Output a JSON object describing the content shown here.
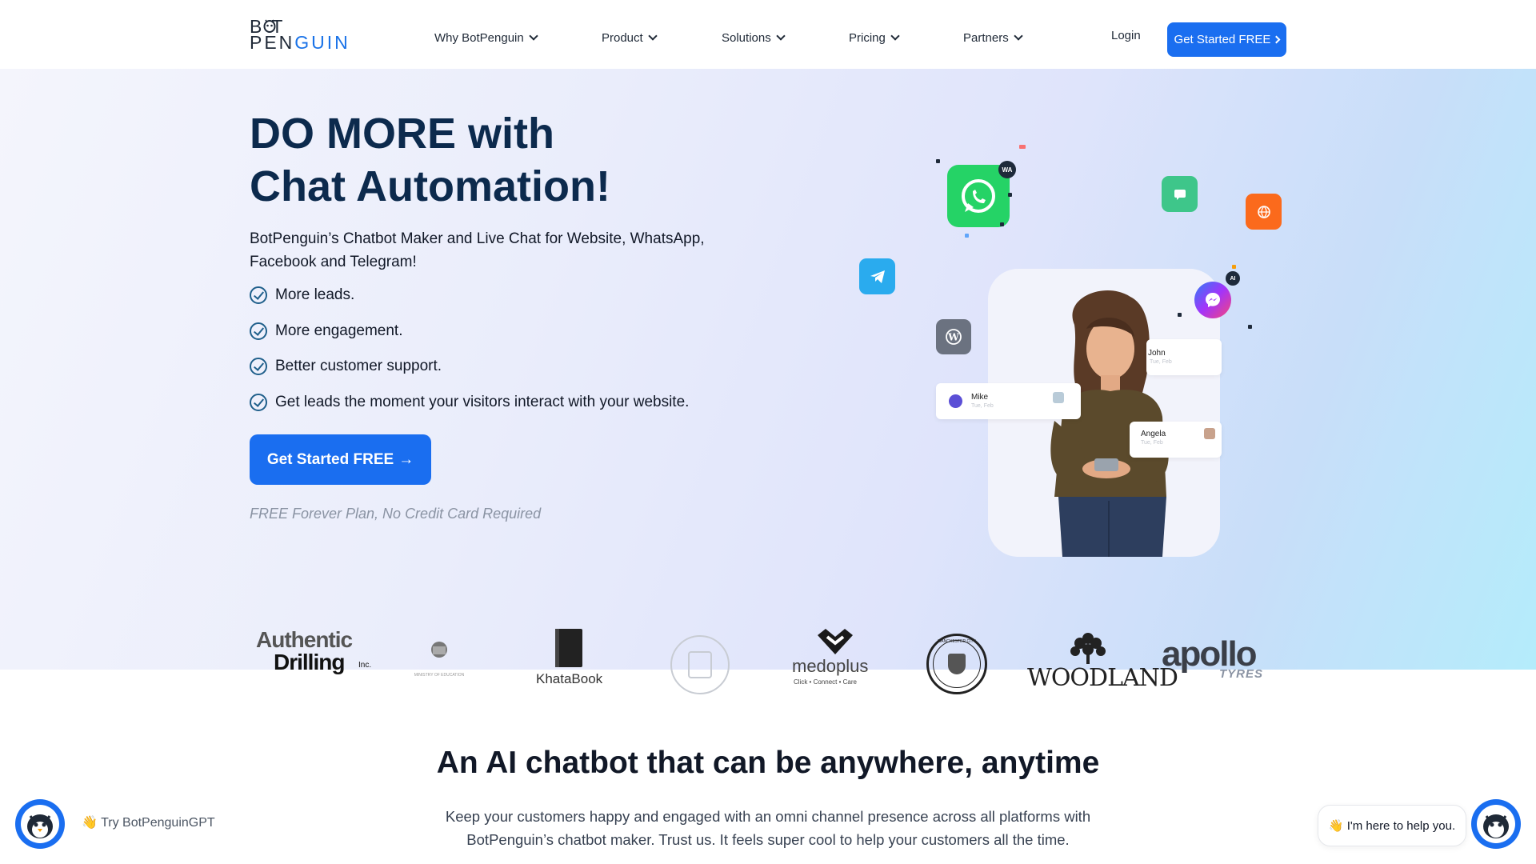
{
  "header": {
    "logo_line1": "B  T",
    "logo_line2_a": "PEN",
    "logo_line2_b": "GUIN",
    "nav": [
      {
        "label": "Why BotPenguin"
      },
      {
        "label": "Product"
      },
      {
        "label": "Solutions"
      },
      {
        "label": "Pricing"
      },
      {
        "label": "Partners"
      }
    ],
    "login_label": "Login",
    "cta_label": "Get Started FREE"
  },
  "hero": {
    "title_line1": "DO MORE with",
    "title_line2": "Chat Automation!",
    "subtitle": "BotPenguin’s Chatbot Maker and Live Chat for Website, WhatsApp, Facebook and Telegram!",
    "checks": [
      "More leads.",
      "More engagement.",
      "Better customer support.",
      "Get leads the moment your visitors interact with your website."
    ],
    "cta_label": "Get Started FREE",
    "free_note": "FREE Forever Plan, No Credit Card Required",
    "chat_cards": [
      {
        "name": "Mike",
        "meta": "Tue, Feb"
      },
      {
        "name": "John",
        "meta": "Tue, Feb"
      },
      {
        "name": "Angela",
        "meta": "Tue, Feb"
      }
    ],
    "wa_badge": "WA",
    "ai_badge": "AI"
  },
  "logos": [
    {
      "name": "Authentic Drilling",
      "line1": "Authentic",
      "line2": "Drilling",
      "suffix": "Inc."
    },
    {
      "name": "Ministry of Education",
      "caption": "MINISTRY OF EDUCATION"
    },
    {
      "name": "KhataBook",
      "text": "KhataBook"
    },
    {
      "name": "University seal"
    },
    {
      "name": "medoplus",
      "text": "medoplus",
      "tagline": "Click • Connect • Care"
    },
    {
      "name": "Manchester City",
      "text": "MANCHESTER CITY"
    },
    {
      "name": "Woodland",
      "text": "WOODLAND"
    },
    {
      "name": "Apollo Tyres",
      "text": "apollo",
      "sub": "TYRES"
    }
  ],
  "section2": {
    "title": "An AI chatbot that can be anywhere, anytime",
    "subtitle": "Keep your customers happy and engaged with an omni channel presence across all platforms with BotPenguin’s chatbot maker. Trust us. It feels super cool to help your customers all the time."
  },
  "widgets": {
    "try_gpt": "👋 Try BotPenguinGPT",
    "help": "👋 I'm here to help you."
  },
  "colors": {
    "primary": "#1a6ef0",
    "heading": "#0c2a4d",
    "whatsapp": "#25d366",
    "telegram": "#2aabee",
    "messenger": "#a334fa"
  },
  "icons": [
    "whatsapp-icon",
    "telegram-icon",
    "wordpress-icon",
    "messenger-icon",
    "chat-icon",
    "web-icon",
    "check-circle-icon",
    "chevron-down-icon",
    "arrow-right-icon"
  ]
}
